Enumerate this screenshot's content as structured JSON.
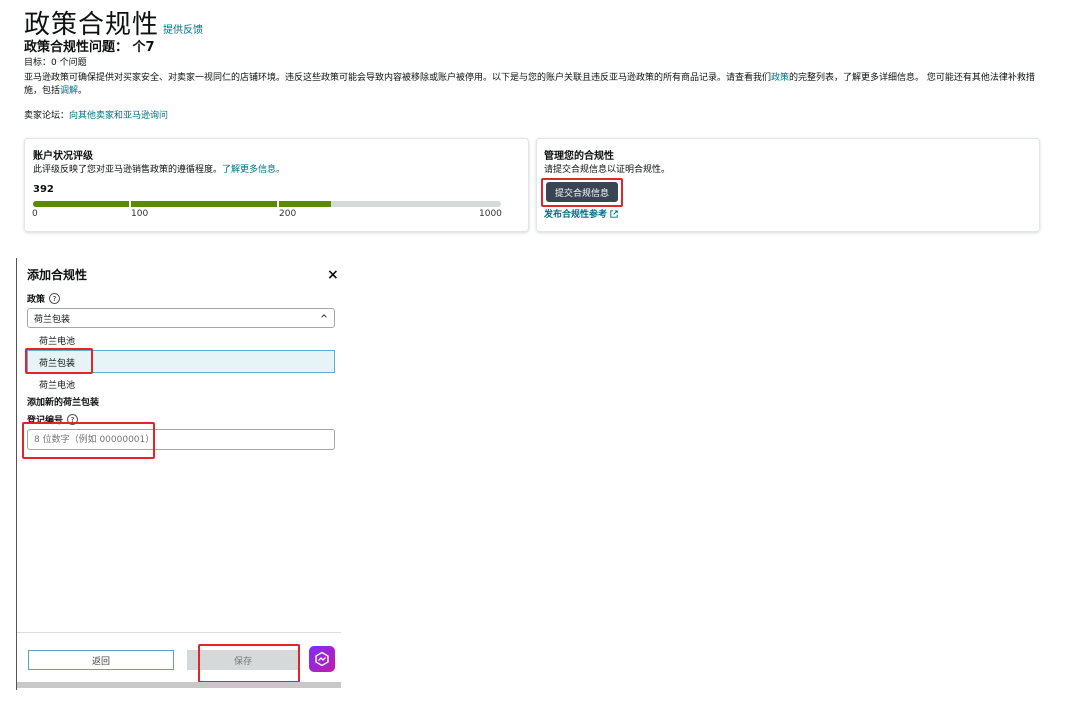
{
  "header": {
    "title": "政策合规性",
    "feedback_link": "提供反馈",
    "subtitle": "政策合规性问题： 个7",
    "goal": "目标：0 个问题",
    "description_part1": "亚马逊政策可确保提供对买家安全、对卖家一视同仁的店铺环境。违反这些政策可能会导致内容被移除或账户被停用。以下是与您的账户关联且违反亚马逊政策的所有商品记录。请查看我们",
    "description_link1": "政策",
    "description_part2": "的完整列表，了解更多详细信息。 您可能还有其他法律补救措施，包括",
    "description_link2": "调解",
    "description_part3": "。",
    "forum_label": "卖家论坛：",
    "forum_link": "向其他卖家和亚马逊询问"
  },
  "account_health": {
    "title": "账户状况评级",
    "description": "此评级反映了您对亚马逊销售政策的遵循程度。",
    "learn_more": "了解更多信息。",
    "score": "392",
    "score_value": 392,
    "scale_max": 1000,
    "tick_labels": [
      "0",
      "100",
      "200",
      "1000"
    ],
    "bar_color": "#5a8a00"
  },
  "manage_compliance": {
    "title": "管理您的合规性",
    "description": "请提交合规信息以证明合规性。",
    "submit_button": "提交合规信息",
    "publish_link": "发布合规性参考"
  },
  "add_compliance": {
    "title": "添加合规性",
    "close_icon": "×",
    "policy_label": "政策",
    "policy_selected": "荷兰包装",
    "dropdown_options": [
      "荷兰电池",
      "荷兰包装",
      "荷兰电池"
    ],
    "section_title": "添加新的荷兰包装",
    "registration_label": "登记编号",
    "registration_placeholder": "8 位数字（例如 00000001）",
    "back_button": "返回",
    "save_button": "保存"
  }
}
